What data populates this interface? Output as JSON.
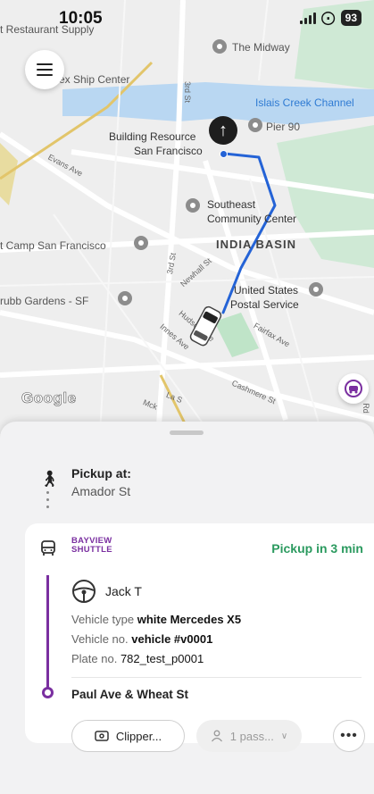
{
  "status_bar": {
    "time": "10:05",
    "battery": "93",
    "wifi_icon": "wifi-icon",
    "signal_icon": "signal-icon"
  },
  "map": {
    "labels": {
      "restaurant_supply": "t Restaurant Supply",
      "midway": "The Midway",
      "ship_center": "ex Ship Center",
      "third_st_top": "3rd St",
      "islais": "Islais Creek Channel",
      "pier90": "Pier 90",
      "building_resources_1": "Building Resource",
      "building_resources_2": "San Francisco",
      "evans": "Evans Ave",
      "southeast_1": "Southeast",
      "southeast_2": "Community Center",
      "camp_sf": "t Camp San Francisco",
      "third_st": "3rd St",
      "india_basin": "INDIA BASIN",
      "newhall": "Newhall St",
      "usps_1": "United States",
      "usps_2": "Postal Service",
      "grubb": "rubb Gardens - SF",
      "hudson": "Hudson Ave",
      "innes": "Innes Ave",
      "fairfax": "Fairfax Ave",
      "la_salle": "La S",
      "cashmere": "Cashmere St",
      "mck": "Mck",
      "rd": "Rd"
    },
    "google": "Google",
    "route_color": "#2463d6",
    "water_color": "#b9d7f2",
    "park_color": "#cfe9d5"
  },
  "sheet": {
    "pickup_label": "Pickup at:",
    "pickup_street": "Amador St",
    "brand_line1": "BAYVIEW",
    "brand_line2": "SHUTTLE",
    "eta": "Pickup in 3 min",
    "driver_name": "Jack T",
    "vehicle_type_label": "Vehicle type",
    "vehicle_type_value": "white Mercedes X5",
    "vehicle_no_label": "Vehicle no.",
    "vehicle_no_value": "vehicle #v0001",
    "plate_label": "Plate no.",
    "plate_value": "782_test_p0001",
    "dropoff": "Paul Ave & Wheat St",
    "clipper_button": "Clipper...",
    "passengers": "1 pass...",
    "more": "•••",
    "accent_color": "#7a2fa0",
    "eta_color": "#2b9a5f"
  }
}
